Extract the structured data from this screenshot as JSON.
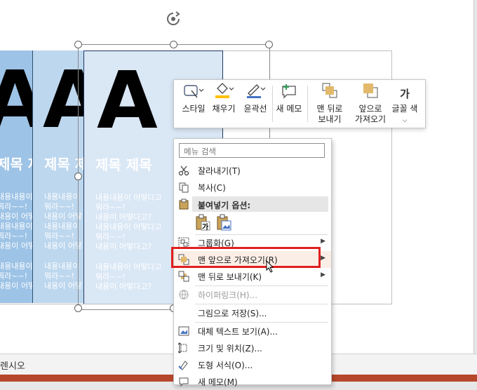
{
  "slide": {
    "letters": [
      "A",
      "A",
      "A"
    ],
    "titles": [
      "제목 제",
      "제목 제",
      "제목 제목"
    ],
    "body_lines_top": [
      "내용내용이",
      "뭐라~~!",
      "내용이 어떻",
      "내용내용이",
      "뭐라~~!",
      "내용이 어떻"
    ],
    "body_lines_bottom": [
      "내용내용이",
      "뭐라~~!",
      "내용이 어떻"
    ],
    "body_lines_top_c3": [
      "내용내용이 어떻다고",
      "뭐라~~!",
      "내용이 어떻다고?",
      "내용내용이 어떻다고",
      "뭐라~~!",
      "내용이 어떻다고?"
    ],
    "body_lines_bottom_c3": [
      "내용내용이 어떻다고",
      "뭐라~~!",
      "내용이 어떻다고?"
    ]
  },
  "statusbar": {
    "text": "렌시오"
  },
  "mini_toolbar": {
    "buttons": [
      {
        "label": "스타일",
        "icon": "style-icon"
      },
      {
        "label": "채우기",
        "icon": "fill-bucket-icon"
      },
      {
        "label": "윤곽선",
        "icon": "outline-pen-icon"
      },
      {
        "label": "새 메모",
        "icon": "new-comment-icon"
      },
      {
        "label": "맨 뒤로\n보내기",
        "icon": "send-to-back-icon"
      },
      {
        "label": "앞으로\n가져오기",
        "icon": "bring-forward-icon"
      },
      {
        "label": "글꼴 색",
        "icon": "font-color-icon"
      }
    ],
    "font_color_glyph": "가",
    "colors": {
      "fill": "#ffc000",
      "outline": "#4472c4",
      "back_front": "#e2b96b"
    }
  },
  "context_menu": {
    "search_placeholder": "메뉴 검색",
    "items": [
      {
        "label": "잘라내기(T)",
        "icon": "scissors-icon"
      },
      {
        "label": "복사(C)",
        "icon": "copy-icon"
      },
      {
        "label": "붙여넣기 옵션:",
        "icon": "paste-icon"
      },
      {
        "label": "그룹화(G)",
        "icon": "group-icon"
      },
      {
        "label": "맨 앞으로 가져오기(R)",
        "icon": "bring-to-front-icon"
      },
      {
        "label": "맨 뒤로 보내기(K)",
        "icon": "send-to-back-icon"
      },
      {
        "label": "하이퍼링크(H)...",
        "icon": "hyperlink-icon"
      },
      {
        "label": "그림으로 저장(S)...",
        "icon": ""
      },
      {
        "label": "대체 텍스트 보기(A)...",
        "icon": "alt-text-icon"
      },
      {
        "label": "크기 및 위치(Z)...",
        "icon": "size-position-icon"
      },
      {
        "label": "도형 서식(O)...",
        "icon": "format-shape-icon"
      },
      {
        "label": "새 메모(M)",
        "icon": "new-comment-icon"
      }
    ],
    "paste_option_glyph": "가"
  },
  "colors": {
    "highlight_border": "#e0201f",
    "card_light": "#dae7f5",
    "card_mid": "#bdd7ee",
    "card_dark": "#9dc3e6"
  }
}
